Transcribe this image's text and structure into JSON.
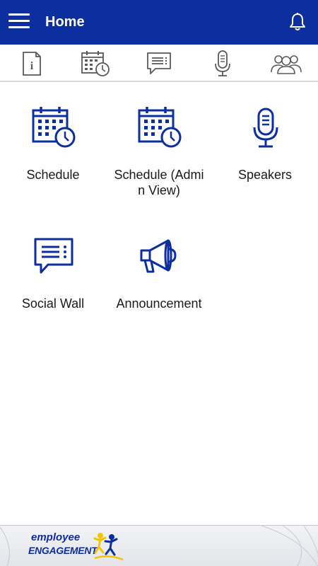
{
  "app_bar": {
    "title": "Home",
    "menu_icon": "hamburger-menu-icon",
    "notification_icon": "bell-icon",
    "background": "#0d2e9f"
  },
  "tabs": [
    {
      "icon": "info-icon"
    },
    {
      "icon": "schedule-calendar-icon"
    },
    {
      "icon": "chat-icon"
    },
    {
      "icon": "microphone-icon"
    },
    {
      "icon": "people-icon"
    }
  ],
  "tiles": [
    {
      "label": "Schedule",
      "icon": "calendar-clock-icon"
    },
    {
      "label": "Schedule (Admin View)",
      "icon": "calendar-clock-icon"
    },
    {
      "label": "Speakers",
      "icon": "microphone-icon"
    },
    {
      "label": "Social Wall",
      "icon": "chat-bubble-icon"
    },
    {
      "label": "Announcement",
      "icon": "megaphone-icon"
    }
  ],
  "footer": {
    "brand_line1": "employee",
    "brand_line2": "ENGAGEMENT",
    "accent_color": "#f5c400"
  },
  "colors": {
    "icon_blue": "#0d2e9f",
    "tab_icon_gray": "#5a5a5a"
  }
}
